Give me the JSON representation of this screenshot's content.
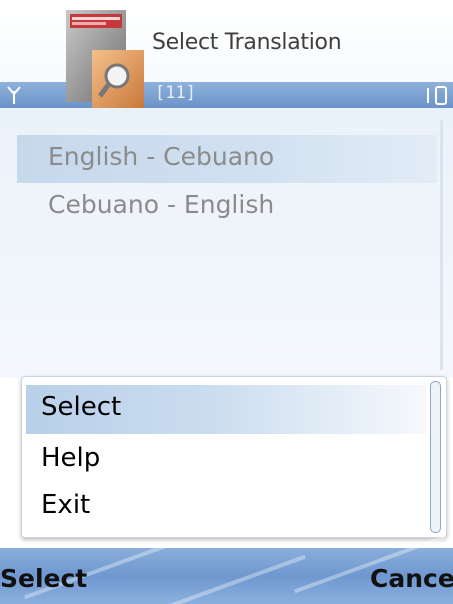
{
  "title_bar": {
    "title": "Select Translation",
    "counter": "[11]"
  },
  "icons": {
    "app": "dictionary-app-icon",
    "signal": "signal-antenna-icon",
    "battery": "battery-icon"
  },
  "list": {
    "items": [
      {
        "label": "English - Cebuano",
        "highlighted": true
      },
      {
        "label": "Cebuano - English",
        "highlighted": false
      }
    ]
  },
  "options_menu": {
    "items": [
      {
        "label": "Select",
        "highlighted": true
      },
      {
        "label": "Help",
        "highlighted": false
      },
      {
        "label": "Exit",
        "highlighted": false
      }
    ]
  },
  "softkeys": {
    "left": "Select",
    "right": "Cancel"
  },
  "colors": {
    "accent": "#6b93c8",
    "highlight": "#c6d8ec"
  }
}
